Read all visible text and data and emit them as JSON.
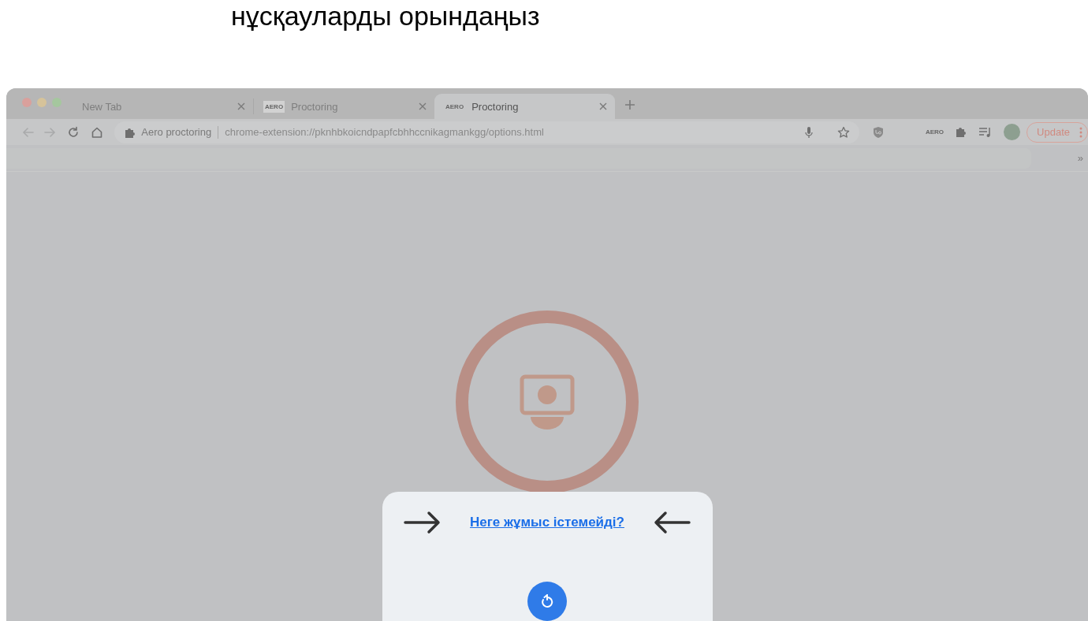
{
  "heading": "нұсқауларды орындаңыз",
  "browser": {
    "tabs": [
      {
        "title": "New Tab",
        "selected": false
      },
      {
        "favicon_text": "AERO",
        "title": "Proctoring",
        "selected": false
      },
      {
        "favicon_text": "AERO",
        "title": "Proctoring",
        "selected": true
      }
    ],
    "nav_buttons": [
      {
        "kind": "back",
        "disabled": true
      },
      {
        "kind": "forward",
        "disabled": true
      },
      {
        "kind": "reload",
        "disabled": false
      },
      {
        "kind": "home",
        "disabled": false
      }
    ],
    "omnibox": {
      "site_label": "Aero proctoring",
      "url": "chrome-extension://pknhbkoicndpapfcbhhccnikagmankgg/options.html"
    },
    "extension_text": "AERO",
    "update_label": "Update",
    "bookmarks_overflow": "»"
  },
  "dialog": {
    "link": "Неге жұмыс істемейді?"
  }
}
